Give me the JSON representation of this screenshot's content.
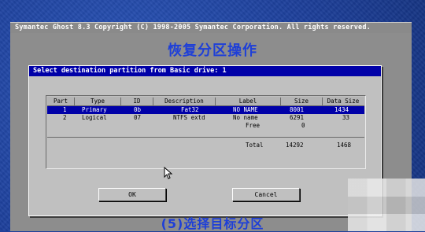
{
  "app": {
    "header_text": "Symantec Ghost 8.3   Copyright (C) 1998-2005 Symantec Corporation. All rights reserved."
  },
  "caption_top": "恢复分区操作",
  "caption_bottom": "(5)选择目标分区",
  "dialog": {
    "title": "Select destination partition from Basic drive: 1",
    "columns": [
      "Part",
      "Type",
      "ID",
      "Description",
      "Label",
      "Size",
      "Data Size"
    ],
    "rows": [
      {
        "part": "1",
        "type": "Primary",
        "id": "0b",
        "description": "Fat32",
        "label": "NO NAME",
        "size": "8001",
        "data_size": "1434",
        "selected": true
      },
      {
        "part": "2",
        "type": "Logical",
        "id": "07",
        "description": "NTFS extd",
        "label": "No name",
        "size": "6291",
        "data_size": "33",
        "selected": false
      },
      {
        "part": "",
        "type": "",
        "id": "",
        "description": "",
        "label": "Free",
        "size": "0",
        "data_size": "",
        "selected": false
      }
    ],
    "total": {
      "label": "Total",
      "size": "14292",
      "data_size": "1468"
    },
    "ok_button": "OK",
    "cancel_button": "Cancel"
  },
  "colors": {
    "desktop_blue": "#1d3f9a",
    "title_bar": "#0000a8",
    "panel_gray": "#c0c0c0",
    "caption_blue": "#1e3fd8"
  }
}
